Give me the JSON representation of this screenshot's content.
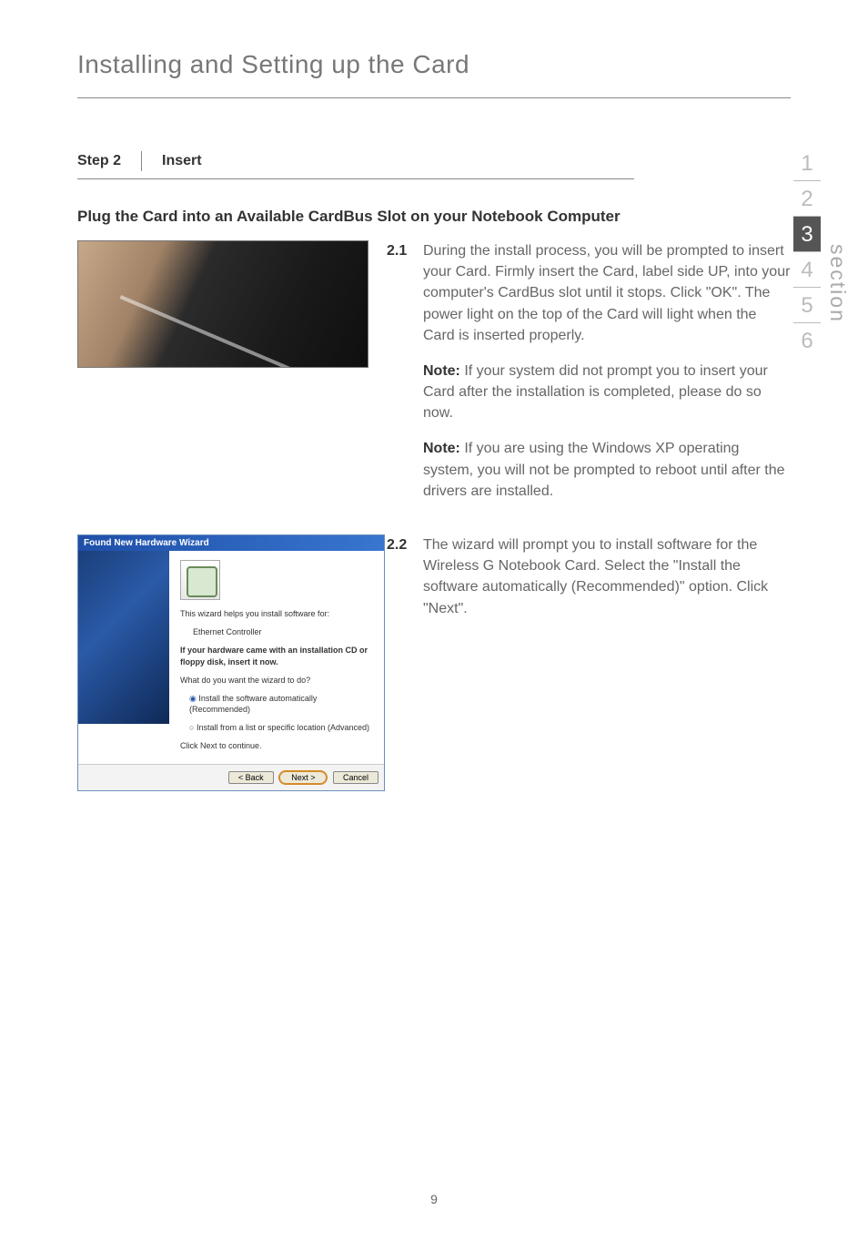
{
  "page": {
    "title": "Installing and Setting up the Card",
    "number": "9"
  },
  "step": {
    "label": "Step 2",
    "name": "Insert"
  },
  "subheading": "Plug the Card into an Available CardBus Slot on your Notebook Computer",
  "items": [
    {
      "num": "2.1",
      "body": "During the install process, you will be prompted to insert your Card. Firmly insert the Card, label side UP, into your computer's CardBus slot until it stops. Click \"OK\". The power light on the top of the Card will light when the Card is inserted properly.",
      "notes": [
        {
          "label": "Note:",
          "text": " If your system did not prompt you to insert your Card after the installation is completed, please do so now."
        },
        {
          "label": "Note:",
          "text": " If you are using the Windows XP operating system, you will not be prompted to reboot until after the drivers are installed."
        }
      ]
    },
    {
      "num": "2.2",
      "body": "The wizard will prompt you to install software for the Wireless G Notebook Card. Select the \"Install the software automatically (Recommended)\" option. Click \"Next\"."
    }
  ],
  "wizard": {
    "title": "Found New Hardware Wizard",
    "line1": "This wizard helps you install software for:",
    "device": "Ethernet Controller",
    "hint": "If your hardware came with an installation CD or floppy disk, insert it now.",
    "question": "What do you want the wizard to do?",
    "opt1": "Install the software automatically (Recommended)",
    "opt2": "Install from a list or specific location (Advanced)",
    "cont": "Click Next to continue.",
    "back": "< Back",
    "next": "Next >",
    "cancel": "Cancel"
  },
  "tabs": [
    "1",
    "2",
    "3",
    "4",
    "5",
    "6"
  ],
  "active_tab": "3",
  "section_label": "section"
}
